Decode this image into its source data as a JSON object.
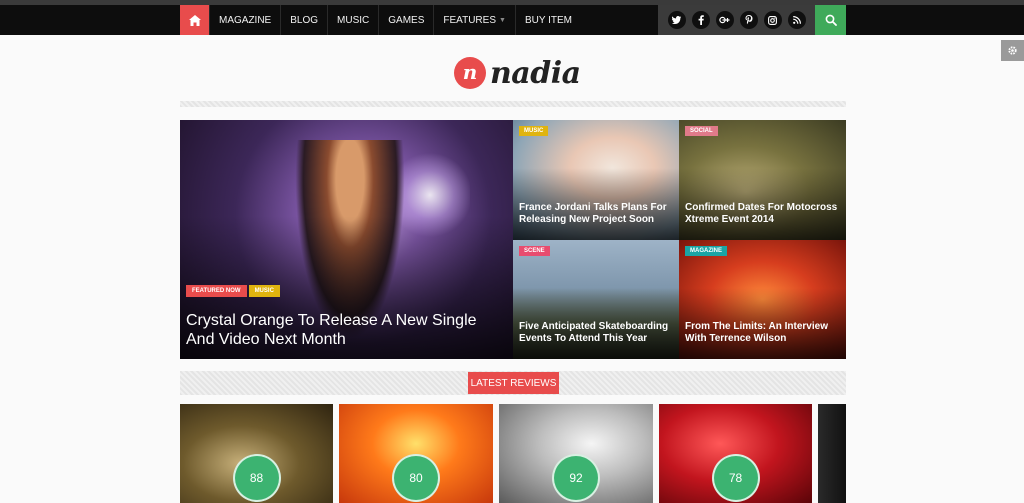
{
  "nav": {
    "items": [
      {
        "label": "MAGAZINE",
        "caret": false
      },
      {
        "label": "BLOG",
        "caret": false
      },
      {
        "label": "MUSIC",
        "caret": false
      },
      {
        "label": "GAMES",
        "caret": false
      },
      {
        "label": "FEATURES",
        "caret": true
      },
      {
        "label": "BUY ITEM",
        "caret": false
      }
    ],
    "social_icons": [
      "twitter-icon",
      "facebook-icon",
      "google-plus-icon",
      "pinterest-icon",
      "instagram-icon",
      "rss-icon"
    ],
    "accent_color": "#e84c4c",
    "search_color": "#3faa5a"
  },
  "logo": {
    "mark": "n",
    "text": "nadia"
  },
  "featured": {
    "badges": [
      "FEATURED NOW",
      "MUSIC"
    ],
    "badge_colors": [
      "#e84c4c",
      "#e0b40f"
    ],
    "title": "Crystal Orange To Release A New Single And Video Next Month"
  },
  "tiles": [
    {
      "badge": "MUSIC",
      "badge_color": "#e0b40f",
      "title": "France Jordani Talks Plans For Releasing New Project Soon"
    },
    {
      "badge": "SOCIAL",
      "badge_color": "#e07a8a",
      "title": "Confirmed Dates For Motocross Xtreme Event 2014"
    },
    {
      "badge": "SCENE",
      "badge_color": "#e84c6e",
      "title": "Five Anticipated Skateboarding Events To Attend This Year"
    },
    {
      "badge": "MAGAZINE",
      "badge_color": "#1aa5a5",
      "title": "From The Limits: An Interview With Terrence Wilson"
    }
  ],
  "reviews": {
    "label": "LATEST REVIEWS",
    "scores": [
      "88",
      "80",
      "92",
      "78"
    ]
  }
}
